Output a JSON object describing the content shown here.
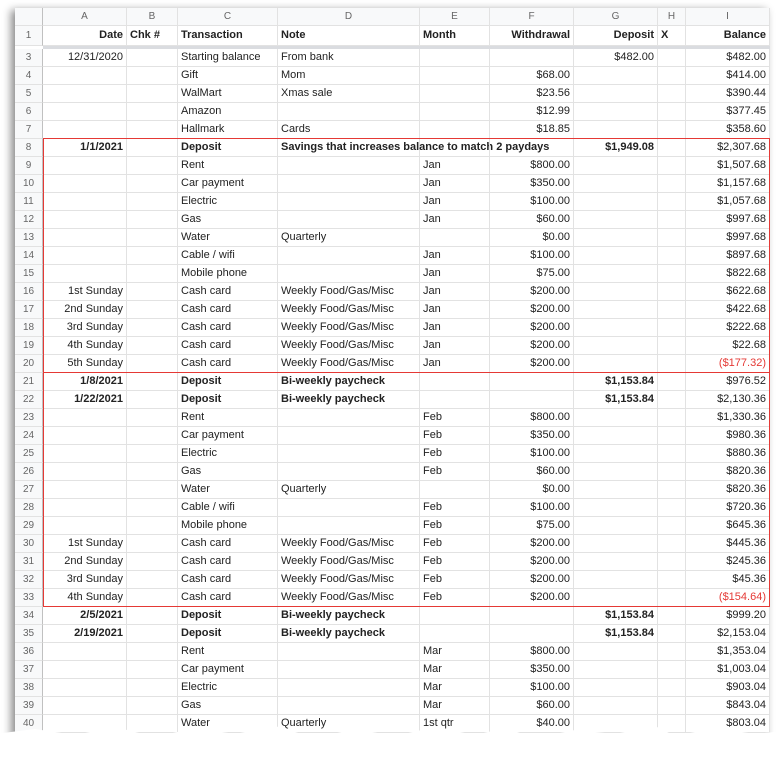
{
  "columns": [
    "A",
    "B",
    "C",
    "D",
    "E",
    "F",
    "G",
    "H",
    "I"
  ],
  "header_row": {
    "num": "1",
    "cells": [
      "Date",
      "Chk #",
      "Transaction",
      "Note",
      "Month",
      "Withdrawal",
      "Deposit",
      "X",
      "Balance"
    ]
  },
  "rows": [
    {
      "n": "3",
      "c": [
        "12/31/2020",
        "",
        "Starting balance",
        "From bank",
        "",
        "",
        "$482.00",
        "",
        "$482.00"
      ]
    },
    {
      "n": "4",
      "c": [
        "",
        "",
        "Gift",
        "Mom",
        "",
        "$68.00",
        "",
        "",
        "$414.00"
      ]
    },
    {
      "n": "5",
      "c": [
        "",
        "",
        "WalMart",
        "Xmas sale",
        "",
        "$23.56",
        "",
        "",
        "$390.44"
      ]
    },
    {
      "n": "6",
      "c": [
        "",
        "",
        "Amazon",
        "",
        "",
        "$12.99",
        "",
        "",
        "$377.45"
      ]
    },
    {
      "n": "7",
      "c": [
        "",
        "",
        "Hallmark",
        "Cards",
        "",
        "$18.85",
        "",
        "",
        "$358.60"
      ]
    },
    {
      "n": "8",
      "bold": true,
      "c": [
        "1/1/2021",
        "",
        "Deposit",
        "Savings that increases balance to match 2 paydays",
        "",
        "",
        "$1,949.08",
        "",
        "$2,307.68"
      ]
    },
    {
      "n": "9",
      "c": [
        "",
        "",
        "Rent",
        "",
        "Jan",
        "$800.00",
        "",
        "",
        "$1,507.68"
      ]
    },
    {
      "n": "10",
      "c": [
        "",
        "",
        "Car payment",
        "",
        "Jan",
        "$350.00",
        "",
        "",
        "$1,157.68"
      ]
    },
    {
      "n": "11",
      "c": [
        "",
        "",
        "Electric",
        "",
        "Jan",
        "$100.00",
        "",
        "",
        "$1,057.68"
      ]
    },
    {
      "n": "12",
      "c": [
        "",
        "",
        "Gas",
        "",
        "Jan",
        "$60.00",
        "",
        "",
        "$997.68"
      ]
    },
    {
      "n": "13",
      "c": [
        "",
        "",
        "Water",
        "Quarterly",
        "",
        "$0.00",
        "",
        "",
        "$997.68"
      ]
    },
    {
      "n": "14",
      "c": [
        "",
        "",
        "Cable / wifi",
        "",
        "Jan",
        "$100.00",
        "",
        "",
        "$897.68"
      ]
    },
    {
      "n": "15",
      "c": [
        "",
        "",
        "Mobile phone",
        "",
        "Jan",
        "$75.00",
        "",
        "",
        "$822.68"
      ]
    },
    {
      "n": "16",
      "c": [
        "1st Sunday",
        "",
        "Cash card",
        "Weekly Food/Gas/Misc",
        "Jan",
        "$200.00",
        "",
        "",
        "$622.68"
      ]
    },
    {
      "n": "17",
      "c": [
        "2nd Sunday",
        "",
        "Cash card",
        "Weekly Food/Gas/Misc",
        "Jan",
        "$200.00",
        "",
        "",
        "$422.68"
      ]
    },
    {
      "n": "18",
      "c": [
        "3rd Sunday",
        "",
        "Cash card",
        "Weekly Food/Gas/Misc",
        "Jan",
        "$200.00",
        "",
        "",
        "$222.68"
      ]
    },
    {
      "n": "19",
      "c": [
        "4th Sunday",
        "",
        "Cash card",
        "Weekly Food/Gas/Misc",
        "Jan",
        "$200.00",
        "",
        "",
        "$22.68"
      ]
    },
    {
      "n": "20",
      "neg": true,
      "c": [
        "5th Sunday",
        "",
        "Cash card",
        "Weekly Food/Gas/Misc",
        "Jan",
        "$200.00",
        "",
        "",
        "($177.32)"
      ]
    },
    {
      "n": "21",
      "bold": true,
      "c": [
        "1/8/2021",
        "",
        "Deposit",
        "Bi-weekly paycheck",
        "",
        "",
        "$1,153.84",
        "",
        "$976.52"
      ]
    },
    {
      "n": "22",
      "bold": true,
      "c": [
        "1/22/2021",
        "",
        "Deposit",
        "Bi-weekly paycheck",
        "",
        "",
        "$1,153.84",
        "",
        "$2,130.36"
      ]
    },
    {
      "n": "23",
      "c": [
        "",
        "",
        "Rent",
        "",
        "Feb",
        "$800.00",
        "",
        "",
        "$1,330.36"
      ]
    },
    {
      "n": "24",
      "c": [
        "",
        "",
        "Car payment",
        "",
        "Feb",
        "$350.00",
        "",
        "",
        "$980.36"
      ]
    },
    {
      "n": "25",
      "c": [
        "",
        "",
        "Electric",
        "",
        "Feb",
        "$100.00",
        "",
        "",
        "$880.36"
      ]
    },
    {
      "n": "26",
      "c": [
        "",
        "",
        "Gas",
        "",
        "Feb",
        "$60.00",
        "",
        "",
        "$820.36"
      ]
    },
    {
      "n": "27",
      "c": [
        "",
        "",
        "Water",
        "Quarterly",
        "",
        "$0.00",
        "",
        "",
        "$820.36"
      ]
    },
    {
      "n": "28",
      "c": [
        "",
        "",
        "Cable / wifi",
        "",
        "Feb",
        "$100.00",
        "",
        "",
        "$720.36"
      ]
    },
    {
      "n": "29",
      "c": [
        "",
        "",
        "Mobile phone",
        "",
        "Feb",
        "$75.00",
        "",
        "",
        "$645.36"
      ]
    },
    {
      "n": "30",
      "c": [
        "1st Sunday",
        "",
        "Cash card",
        "Weekly Food/Gas/Misc",
        "Feb",
        "$200.00",
        "",
        "",
        "$445.36"
      ]
    },
    {
      "n": "31",
      "c": [
        "2nd Sunday",
        "",
        "Cash card",
        "Weekly Food/Gas/Misc",
        "Feb",
        "$200.00",
        "",
        "",
        "$245.36"
      ]
    },
    {
      "n": "32",
      "c": [
        "3rd Sunday",
        "",
        "Cash card",
        "Weekly Food/Gas/Misc",
        "Feb",
        "$200.00",
        "",
        "",
        "$45.36"
      ]
    },
    {
      "n": "33",
      "neg": true,
      "c": [
        "4th Sunday",
        "",
        "Cash card",
        "Weekly Food/Gas/Misc",
        "Feb",
        "$200.00",
        "",
        "",
        "($154.64)"
      ]
    },
    {
      "n": "34",
      "bold": true,
      "c": [
        "2/5/2021",
        "",
        "Deposit",
        "Bi-weekly paycheck",
        "",
        "",
        "$1,153.84",
        "",
        "$999.20"
      ]
    },
    {
      "n": "35",
      "bold": true,
      "c": [
        "2/19/2021",
        "",
        "Deposit",
        "Bi-weekly paycheck",
        "",
        "",
        "$1,153.84",
        "",
        "$2,153.04"
      ]
    },
    {
      "n": "36",
      "c": [
        "",
        "",
        "Rent",
        "",
        "Mar",
        "$800.00",
        "",
        "",
        "$1,353.04"
      ]
    },
    {
      "n": "37",
      "c": [
        "",
        "",
        "Car payment",
        "",
        "Mar",
        "$350.00",
        "",
        "",
        "$1,003.04"
      ]
    },
    {
      "n": "38",
      "c": [
        "",
        "",
        "Electric",
        "",
        "Mar",
        "$100.00",
        "",
        "",
        "$903.04"
      ]
    },
    {
      "n": "39",
      "c": [
        "",
        "",
        "Gas",
        "",
        "Mar",
        "$60.00",
        "",
        "",
        "$843.04"
      ]
    },
    {
      "n": "40",
      "c": [
        "",
        "",
        "Water",
        "Quarterly",
        "1st qtr",
        "$40.00",
        "",
        "",
        "$803.04"
      ]
    }
  ],
  "colors": {
    "highlight_border": "#e53935",
    "negative": "#e53935"
  }
}
